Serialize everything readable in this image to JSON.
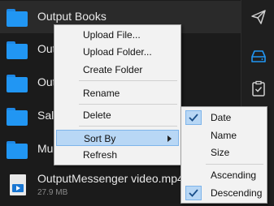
{
  "files": [
    {
      "name": "Output Books",
      "type": "folder",
      "selected": true
    },
    {
      "name": "Out",
      "type": "folder"
    },
    {
      "name": "Outp",
      "type": "folder"
    },
    {
      "name": "Sale",
      "type": "folder"
    },
    {
      "name": "Mu",
      "type": "folder"
    },
    {
      "name": "OutputMessenger video.mp4",
      "type": "video",
      "size": "27.9 MB"
    }
  ],
  "context_menu": {
    "items": [
      "Upload File...",
      "Upload Folder...",
      "Create Folder",
      "Rename",
      "Delete",
      "Sort By",
      "Refresh"
    ]
  },
  "sort_submenu": {
    "fields": [
      "Date",
      "Name",
      "Size"
    ],
    "orders": [
      "Ascending",
      "Descending"
    ],
    "checked_field": "Date",
    "checked_order": "Descending"
  },
  "sidebar_icons": [
    "send-icon",
    "drive-icon",
    "clipboard-check-icon"
  ],
  "colors": {
    "accent": "#2196f3",
    "background": "#1b1b1b",
    "menu_bg": "#f2f2f2",
    "highlight": "#b8d7f5"
  }
}
